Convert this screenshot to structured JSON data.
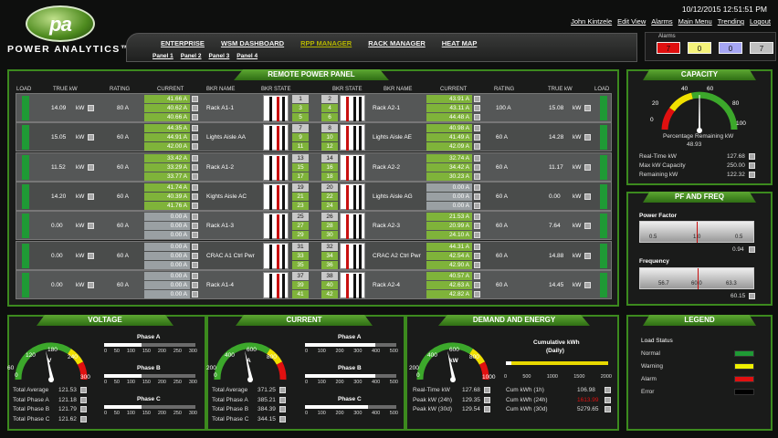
{
  "header": {
    "brand": "POWER ANALYTICS™",
    "logo_text": "pa",
    "datetime": "10/12/2015 12:51:51 PM",
    "links": [
      "John Kintzele",
      "Edit View",
      "Alarms",
      "Main Menu",
      "Trending",
      "Logout"
    ]
  },
  "nav": {
    "tabs": [
      "ENTERPRISE",
      "WSM DASHBOARD",
      "RPP MANAGER",
      "RACK MANAGER",
      "HEAT MAP"
    ],
    "active": "RPP MANAGER",
    "panels": [
      "Panel 1",
      "Panel 2",
      "Panel 3",
      "Panel 4"
    ]
  },
  "alarms": {
    "title": "Alarms",
    "counts": [
      "7",
      "0",
      "0",
      "7"
    ],
    "colors": [
      "#e01010",
      "#f5f37a",
      "#a6a6f5",
      "#c0c0c0"
    ]
  },
  "rpp": {
    "title": "REMOTE POWER PANEL",
    "headers_left": [
      "LOAD",
      "TRUE kW",
      "RATING",
      "CURRENT",
      "BKR NAME",
      "BKR STATE"
    ],
    "headers_right": [
      "BKR STATE",
      "BKR NAME",
      "CURRENT",
      "RATING",
      "TRUE kW",
      "LOAD"
    ],
    "rows": [
      {
        "lkw": "14.09",
        "lrate": "80 A",
        "lcur": [
          "41.66 A",
          "40.62 A",
          "40.66 A"
        ],
        "lname": "Rack A1-1",
        "lnum": [
          "1",
          "3",
          "5"
        ],
        "rnum": [
          "2",
          "4",
          "6"
        ],
        "rname": "Rack A2-1",
        "rcur": [
          "43.91 A",
          "43.11 A",
          "44.48 A"
        ],
        "rrate": "100 A",
        "rkw": "15.08"
      },
      {
        "lkw": "15.05",
        "lrate": "60 A",
        "lcur": [
          "44.35 A",
          "44.91 A",
          "42.00 A"
        ],
        "lname": "Lights Aisle AA",
        "lnum": [
          "7",
          "9",
          "11"
        ],
        "rnum": [
          "8",
          "10",
          "12"
        ],
        "rname": "Lights Aisle AE",
        "rcur": [
          "40.98 A",
          "41.49 A",
          "42.09 A"
        ],
        "rrate": "60 A",
        "rkw": "14.28"
      },
      {
        "lkw": "11.52",
        "lrate": "60 A",
        "lcur": [
          "33.42 A",
          "33.29 A",
          "33.77 A"
        ],
        "lname": "Rack A1-2",
        "lnum": [
          "13",
          "15",
          "17"
        ],
        "rnum": [
          "14",
          "16",
          "18"
        ],
        "rname": "Rack A2-2",
        "rcur": [
          "32.74 A",
          "34.42 A",
          "30.23 A"
        ],
        "rrate": "60 A",
        "rkw": "11.17"
      },
      {
        "lkw": "14.20",
        "lrate": "60 A",
        "lcur": [
          "41.74 A",
          "40.39 A",
          "41.76 A"
        ],
        "lname": "Kights Aisle AC",
        "lnum": [
          "19",
          "21",
          "23"
        ],
        "rnum": [
          "20",
          "22",
          "24"
        ],
        "rname": "Lights Aisle AG",
        "rcur": [
          "0.00 A",
          "0.00 A",
          "0.00 A"
        ],
        "rrate": "60 A",
        "rkw": "0.00"
      },
      {
        "lkw": "0.00",
        "lrate": "60 A",
        "lcur": [
          "0.00 A",
          "0.00 A",
          "0.00 A"
        ],
        "lname": "Rack A1-3",
        "lnum": [
          "25",
          "27",
          "29"
        ],
        "rnum": [
          "26",
          "28",
          "30"
        ],
        "rname": "Rack A2-3",
        "rcur": [
          "21.53 A",
          "20.99 A",
          "24.10 A"
        ],
        "rrate": "60 A",
        "rkw": "7.64"
      },
      {
        "lkw": "0.00",
        "lrate": "60 A",
        "lcur": [
          "0.00 A",
          "0.00 A",
          "0.00 A"
        ],
        "lname": "CRAC A1 Ctrl Pwr",
        "lnum": [
          "31",
          "33",
          "35"
        ],
        "rnum": [
          "32",
          "34",
          "36"
        ],
        "rname": "CRAC A2 Ctrl Pwr",
        "rcur": [
          "44.31 A",
          "42.54 A",
          "42.90 A"
        ],
        "rrate": "60 A",
        "rkw": "14.88"
      },
      {
        "lkw": "0.00",
        "lrate": "60 A",
        "lcur": [
          "0.00 A",
          "0.00 A",
          "0.00 A"
        ],
        "lname": "Rack A1-4",
        "lnum": [
          "37",
          "39",
          "41"
        ],
        "rnum": [
          "38",
          "40",
          "42"
        ],
        "rname": "Rack A2-4",
        "rcur": [
          "40.57 A",
          "42.63 A",
          "42.82 A"
        ],
        "rrate": "60 A",
        "rkw": "14.45"
      }
    ],
    "unit": "kW"
  },
  "capacity": {
    "title": "CAPACITY",
    "ticks": [
      "0",
      "20",
      "40",
      "60",
      "80",
      "100"
    ],
    "pct_label": "Percentage Remaining kW",
    "pct": "48.93",
    "stats": [
      {
        "label": "Real-Time kW",
        "value": "127.68"
      },
      {
        "label": "Max kW Capacity",
        "value": "250.00"
      },
      {
        "label": "Remaining kW",
        "value": "122.32"
      }
    ]
  },
  "pf": {
    "title": "PF AND FREQ",
    "pf_label": "Power Factor",
    "pf_ticks": [
      "0.5",
      "1.0",
      "0.5"
    ],
    "pf_value": "0.94",
    "freq_label": "Frequency",
    "freq_ticks": [
      "56.7",
      "60.0",
      "63.3"
    ],
    "freq_value": "60.15"
  },
  "voltage": {
    "title": "VOLTAGE",
    "ticks": [
      "60",
      "120",
      "180",
      "240",
      "300"
    ],
    "zero": "0",
    "unit": "V",
    "phases": [
      "Phase A",
      "Phase B",
      "Phase C"
    ],
    "scale": [
      "0",
      "50",
      "100",
      "150",
      "200",
      "250",
      "300"
    ],
    "levels": [
      0.41,
      0.41,
      0.41
    ],
    "stats": [
      {
        "label": "Total Average",
        "value": "121.53"
      },
      {
        "label": "Total Phase A",
        "value": "121.18"
      },
      {
        "label": "Total Phase B",
        "value": "121.79"
      },
      {
        "label": "Total Phase C",
        "value": "121.62"
      }
    ]
  },
  "current": {
    "title": "CURRENT",
    "ticks": [
      "200",
      "400",
      "600",
      "800"
    ],
    "zero": "0",
    "unit": "A",
    "phases": [
      "Phase A",
      "Phase B",
      "Phase C"
    ],
    "scale": [
      "0",
      "100",
      "200",
      "300",
      "400",
      "500"
    ],
    "levels": [
      0.77,
      0.77,
      0.69
    ],
    "stats": [
      {
        "label": "Total Average",
        "value": "371.25"
      },
      {
        "label": "Total Phase A",
        "value": "385.21"
      },
      {
        "label": "Total Phase B",
        "value": "384.39"
      },
      {
        "label": "Total Phase C",
        "value": "344.15"
      }
    ]
  },
  "demand": {
    "title": "DEMAND AND ENERGY",
    "ticks": [
      "200",
      "400",
      "600",
      "800",
      "1000"
    ],
    "zero": "0",
    "unit": "kW",
    "cum_title": "Cumulative kWh",
    "cum_sub": "(Daily)",
    "cum_scale": [
      "0",
      "500",
      "1000",
      "1500",
      "2000"
    ],
    "cum_level": 0.05,
    "stats": [
      {
        "label": "Real-Time kW",
        "value": "127.68"
      },
      {
        "label": "Peak kW (24h)",
        "value": "129.35"
      },
      {
        "label": "Peak kW (30d)",
        "value": "129.54"
      }
    ],
    "cum_stats": [
      {
        "label": "Cum kWh (1h)",
        "value": "106.98",
        "color": "#ddd"
      },
      {
        "label": "Cum kWh (24h)",
        "value": "1613.99",
        "color": "#e01010"
      },
      {
        "label": "Cum kWh (30d)",
        "value": "5279.65",
        "color": "#ddd"
      }
    ]
  },
  "legend": {
    "title": "LEGEND",
    "heading": "Load Status",
    "items": [
      {
        "label": "Normal",
        "color": "#1f9a35"
      },
      {
        "label": "Warning",
        "color": "#f0f000"
      },
      {
        "label": "Alarm",
        "color": "#e01010"
      },
      {
        "label": "Error",
        "color": "#000000"
      }
    ]
  }
}
